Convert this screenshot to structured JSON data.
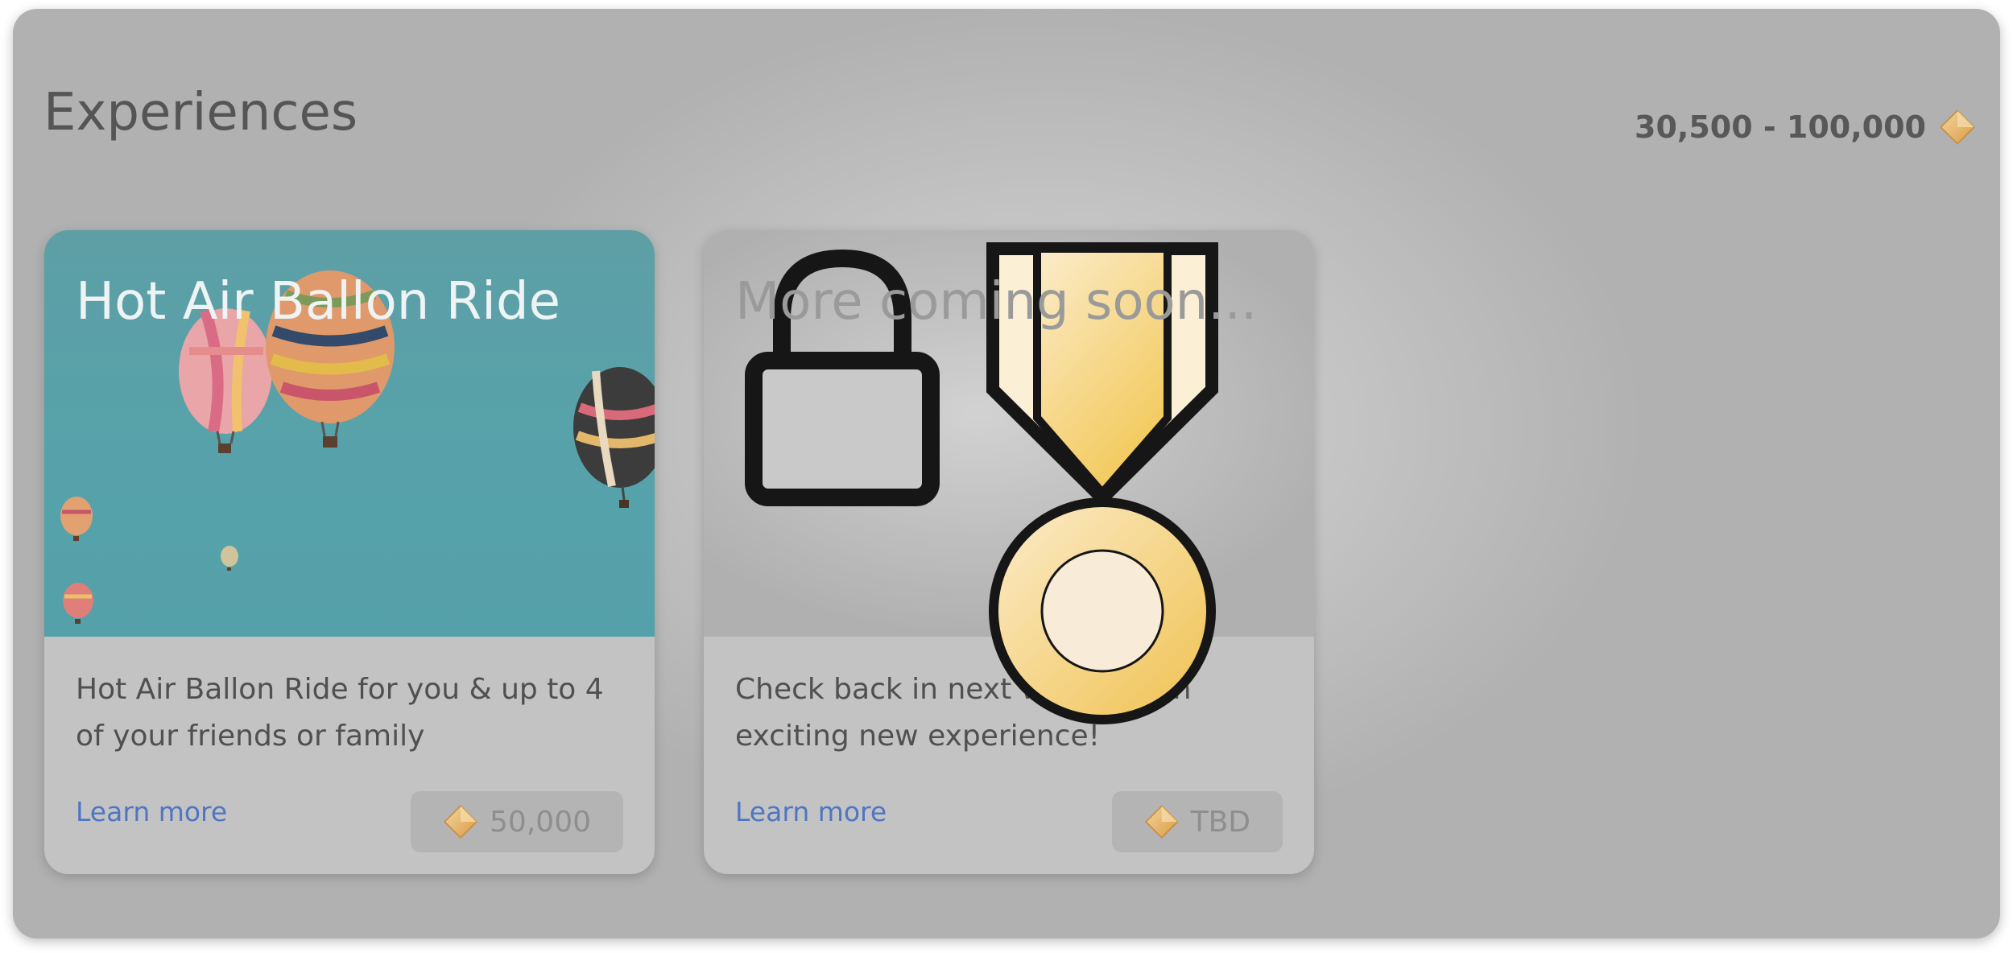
{
  "section": {
    "title": "Experiences",
    "range": "30,500 - 100,000",
    "range_icon": "gem-icon"
  },
  "cards": [
    {
      "title": "Hot Air Ballon Ride",
      "description": "Hot Air Ballon Ride for you & up to 4 of your friends or family",
      "link": "Learn more",
      "price": "50,000",
      "price_icon": "gem-icon"
    },
    {
      "title": "More coming soon...",
      "description": "Check back in next week for an exciting new experience!",
      "link": "Learn more",
      "price": "TBD",
      "price_icon": "gem-icon"
    }
  ],
  "overlay": {
    "icons": [
      "lock-icon",
      "medal-icon"
    ]
  },
  "colors": {
    "link": "#4e76c4",
    "gem": "#e7b86a",
    "medal_gold": "#f2cc6a"
  }
}
